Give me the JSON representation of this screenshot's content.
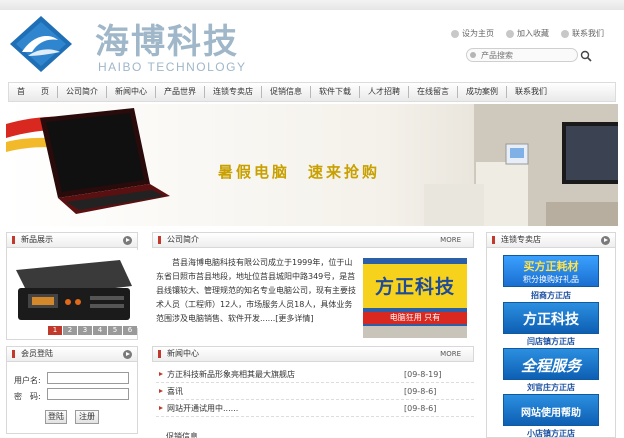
{
  "logo": {
    "cn": "海博科技",
    "en": "HAIBO TECHNOLOGY"
  },
  "toplinks": [
    {
      "label": "设为主页",
      "icon": "home-icon"
    },
    {
      "label": "加入收藏",
      "icon": "favorite-icon"
    },
    {
      "label": "联系我们",
      "icon": "contact-icon"
    }
  ],
  "search": {
    "placeholder": "产品搜索"
  },
  "nav": [
    "首　　页",
    "公司简介",
    "新闻中心",
    "产品世界",
    "连锁专卖店",
    "促销信息",
    "软件下载",
    "人才招聘",
    "在线留言",
    "成功案例",
    "联系我们"
  ],
  "banner": {
    "slogan": "暑假电脑　速来抢购"
  },
  "product_box": {
    "title": "新品展示",
    "pages": [
      "1",
      "2",
      "3",
      "4",
      "5",
      "6"
    ],
    "active_page": "1"
  },
  "intro_box": {
    "title": "公司简介",
    "more": "MORE",
    "text": "莒县海博电脑科技有限公司成立于1999年，位于山东省日照市莒县地段，地址位莒县城阳中路349号，是莒县线镶较大、管理规范的知名专业电脑公司，现有主要技术人员（工程师）12人，市场服务人员18人，具体业务范围涉及电脑销售、软件开发......[更多详情]",
    "store_sign": "方正科技",
    "store_sub": "电脑狂用 只有"
  },
  "news_box": {
    "title": "新闻中心",
    "more": "MORE",
    "items": [
      {
        "title": "方正科技新品形象亮相其最大旗舰店",
        "date": "[09-8-19]"
      },
      {
        "title": "喜讯",
        "date": "[09-8-6]"
      },
      {
        "title": "网站开通试用中......",
        "date": "[09-8-6]"
      }
    ],
    "next_title": "促销信息"
  },
  "login_box": {
    "title": "会员登陆",
    "username_label": "用户名:",
    "password_label": "密　码:",
    "login_button": "登陆",
    "register_button": "注册"
  },
  "stores_box": {
    "title": "连锁专卖店",
    "ads": [
      {
        "text": "买方正耗材",
        "sub": "积分换购好礼品",
        "caption": "招商方正店"
      },
      {
        "text": "方正科技",
        "sub": "",
        "caption": "闫店镇方正店"
      },
      {
        "text": "全程服务",
        "sub": "",
        "caption": "刘官庄方正店"
      },
      {
        "text": "网站使用帮助",
        "sub": "",
        "caption": "小店镇方正店"
      }
    ]
  },
  "colors": {
    "accent": "#c0392b",
    "logo": "#9fb7c9",
    "slogan": "#c8a000",
    "ad_blue": "#0e5fb3"
  }
}
